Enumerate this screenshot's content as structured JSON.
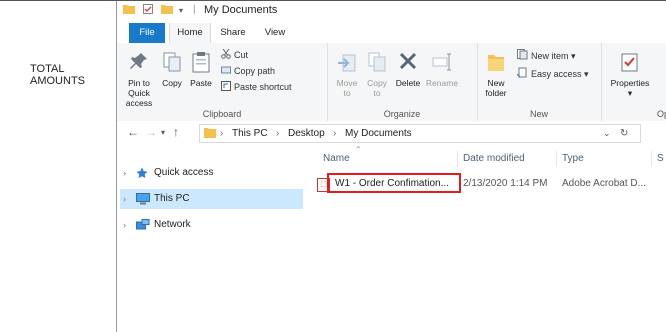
{
  "page": {
    "left_label": "TOTAL AMOUNTS"
  },
  "titlebar": {
    "title": "My Documents"
  },
  "tabs": [
    {
      "label": "File"
    },
    {
      "label": "Home"
    },
    {
      "label": "Share"
    },
    {
      "label": "View"
    }
  ],
  "ribbon": {
    "clipboard": {
      "label": "Clipboard",
      "pin": "Pin to Quick access",
      "copy": "Copy",
      "paste": "Paste",
      "cut": "Cut",
      "copy_path": "Copy path",
      "paste_shortcut": "Paste shortcut"
    },
    "organize": {
      "label": "Organize",
      "move_to": "Move to",
      "copy_to": "Copy to",
      "delete": "Delete",
      "rename": "Rename"
    },
    "new": {
      "label": "New",
      "new_folder": "New folder",
      "new_item": "New item",
      "easy_access": "Easy access"
    },
    "open": {
      "label": "Op",
      "properties": "Properties"
    }
  },
  "address": {
    "crumbs": [
      "This PC",
      "Desktop",
      "My Documents"
    ]
  },
  "nav": {
    "items": [
      {
        "label": "Quick access",
        "icon": "star-icon"
      },
      {
        "label": "This PC",
        "icon": "computer-icon",
        "selected": true
      },
      {
        "label": "Network",
        "icon": "network-icon"
      }
    ]
  },
  "files": {
    "columns": [
      "Name",
      "Date modified",
      "Type",
      "S"
    ],
    "rows": [
      {
        "name": "W1 - Order Confimation...",
        "date": "2/13/2020 1:14 PM",
        "type": "Adobe Acrobat D..."
      }
    ]
  },
  "colors": {
    "file_tab": "#1979ca",
    "selection": "#cce8ff",
    "highlight_box": "#e31b1b"
  }
}
